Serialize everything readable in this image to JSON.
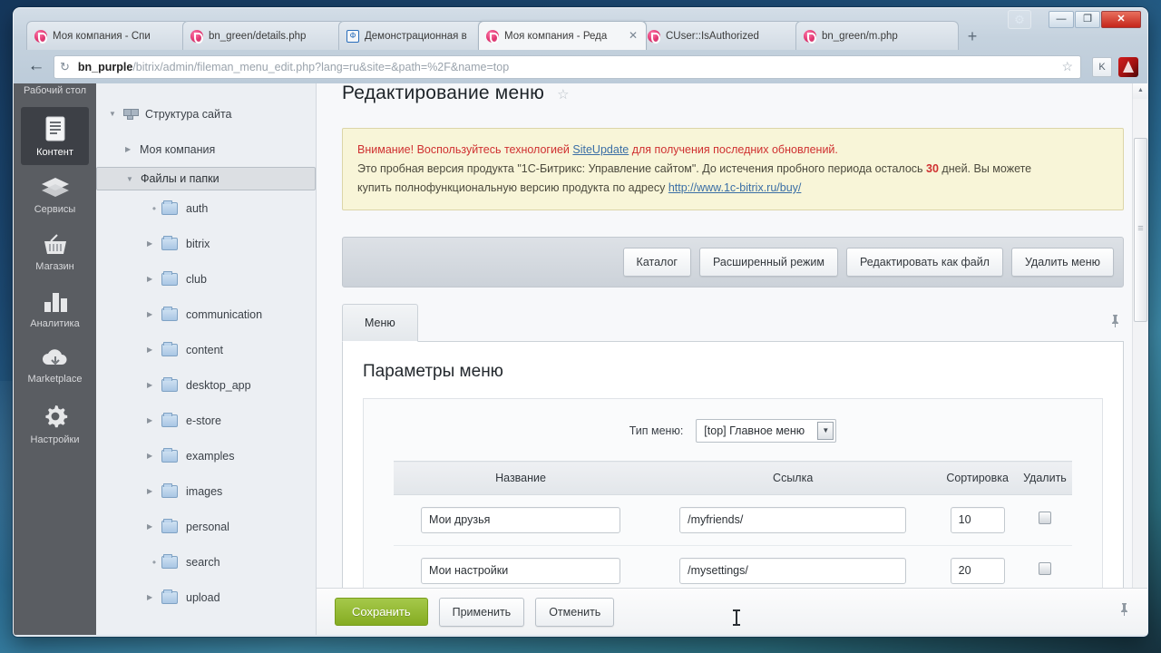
{
  "browser": {
    "tabs": [
      {
        "title": "Моя компания - Спи",
        "active": false,
        "favicon": "bitrix-logo-icon"
      },
      {
        "title": "bn_green/details.php",
        "active": false,
        "favicon": "bitrix-logo-icon"
      },
      {
        "title": "Демонстрационная в",
        "active": false,
        "favicon": "demo-site-icon"
      },
      {
        "title": "Моя компания - Реда",
        "active": true,
        "favicon": "bitrix-logo-icon"
      },
      {
        "title": "CUser::IsAuthorized",
        "active": false,
        "favicon": "bitrix-logo-icon"
      },
      {
        "title": "bn_green/m.php",
        "active": false,
        "favicon": "bitrix-logo-icon"
      }
    ],
    "new_tab_label": "+",
    "back_label": "←",
    "reload_label": "↻",
    "url_host": "bn_purple",
    "url_path": "/bitrix/admin/fileman_menu_edit.php?lang=ru&site=&path=%2F&name=top",
    "star_label": "☆",
    "extension_label": "K",
    "window_controls": {
      "minimize": "—",
      "maximize": "❐",
      "close": "✕"
    },
    "gear_label": "⚙"
  },
  "rail": {
    "items": [
      {
        "label": "Рабочий стол",
        "icon": "desktop-icon",
        "active": false
      },
      {
        "label": "Контент",
        "icon": "document-icon",
        "active": true
      },
      {
        "label": "Сервисы",
        "icon": "layers-icon",
        "active": false
      },
      {
        "label": "Магазин",
        "icon": "basket-icon",
        "active": false
      },
      {
        "label": "Аналитика",
        "icon": "bar-chart-icon",
        "active": false
      },
      {
        "label": "Marketplace",
        "icon": "cloud-download-icon",
        "active": false
      },
      {
        "label": "Настройки",
        "icon": "gear-icon",
        "active": false
      }
    ]
  },
  "tree": {
    "root": {
      "label": "Структура сайта",
      "icon": "site-structure-icon",
      "expanded": true
    },
    "nodes": [
      {
        "label": "Моя компания",
        "level": 2,
        "state": "collapsed",
        "icon": "none",
        "selected": false
      },
      {
        "label": "Файлы и папки",
        "level": 2,
        "state": "expanded",
        "icon": "none",
        "selected": true
      },
      {
        "label": "auth",
        "level": 3,
        "state": "leaf",
        "icon": "folder-icon",
        "selected": false
      },
      {
        "label": "bitrix",
        "level": 3,
        "state": "collapsed",
        "icon": "folder-icon",
        "selected": false
      },
      {
        "label": "club",
        "level": 3,
        "state": "collapsed",
        "icon": "folder-icon",
        "selected": false
      },
      {
        "label": "communication",
        "level": 3,
        "state": "collapsed",
        "icon": "folder-icon",
        "selected": false
      },
      {
        "label": "content",
        "level": 3,
        "state": "collapsed",
        "icon": "folder-icon",
        "selected": false
      },
      {
        "label": "desktop_app",
        "level": 3,
        "state": "collapsed",
        "icon": "folder-icon",
        "selected": false
      },
      {
        "label": "e-store",
        "level": 3,
        "state": "collapsed",
        "icon": "folder-icon",
        "selected": false
      },
      {
        "label": "examples",
        "level": 3,
        "state": "collapsed",
        "icon": "folder-icon",
        "selected": false
      },
      {
        "label": "images",
        "level": 3,
        "state": "collapsed",
        "icon": "folder-icon",
        "selected": false
      },
      {
        "label": "personal",
        "level": 3,
        "state": "collapsed",
        "icon": "folder-icon",
        "selected": false
      },
      {
        "label": "search",
        "level": 3,
        "state": "leaf",
        "icon": "folder-icon",
        "selected": false
      },
      {
        "label": "upload",
        "level": 3,
        "state": "collapsed",
        "icon": "folder-icon",
        "selected": false
      }
    ]
  },
  "page": {
    "title": "Редактирование меню",
    "favorite_star": "☆",
    "notice": {
      "line1_warn": "Внимание!",
      "line1_a": " Воспользуйтесь технологией ",
      "line1_link": "SiteUpdate",
      "line1_b": " для получения последних обновлений.",
      "line2_a": "Это пробная версия продукта \"1С-Битрикс: Управление сайтом\". До истечения пробного периода осталось ",
      "line2_days": "30",
      "line2_b": " дней. Вы можете",
      "line3_a": "купить полнофункциональную версию продукта по адресу ",
      "line3_link": "http://www.1c-bitrix.ru/buy/"
    },
    "toolbar": {
      "catalog": "Каталог",
      "advanced_mode": "Расширенный режим",
      "edit_as_file": "Редактировать как файл",
      "delete_menu": "Удалить меню"
    },
    "tab_label": "Меню",
    "pin_label": "📌",
    "panel_title": "Параметры меню",
    "menu_type_label": "Тип меню:",
    "menu_type_value": "[top] Главное меню",
    "select_arrow": "▼",
    "table": {
      "headers": [
        "Название",
        "Ссылка",
        "Сортировка",
        "Удалить"
      ],
      "rows": [
        {
          "name": "Мои друзья",
          "link": "/myfriends/",
          "sort": "10",
          "delete": false
        },
        {
          "name": "Мои настройки",
          "link": "/mysettings/",
          "sort": "20",
          "delete": false
        }
      ]
    },
    "savebar": {
      "save": "Сохранить",
      "apply": "Применить",
      "cancel": "Отменить",
      "pin": "📌"
    }
  },
  "scrollbar": {
    "up": "▲",
    "down": "▼",
    "grip": "≡"
  }
}
